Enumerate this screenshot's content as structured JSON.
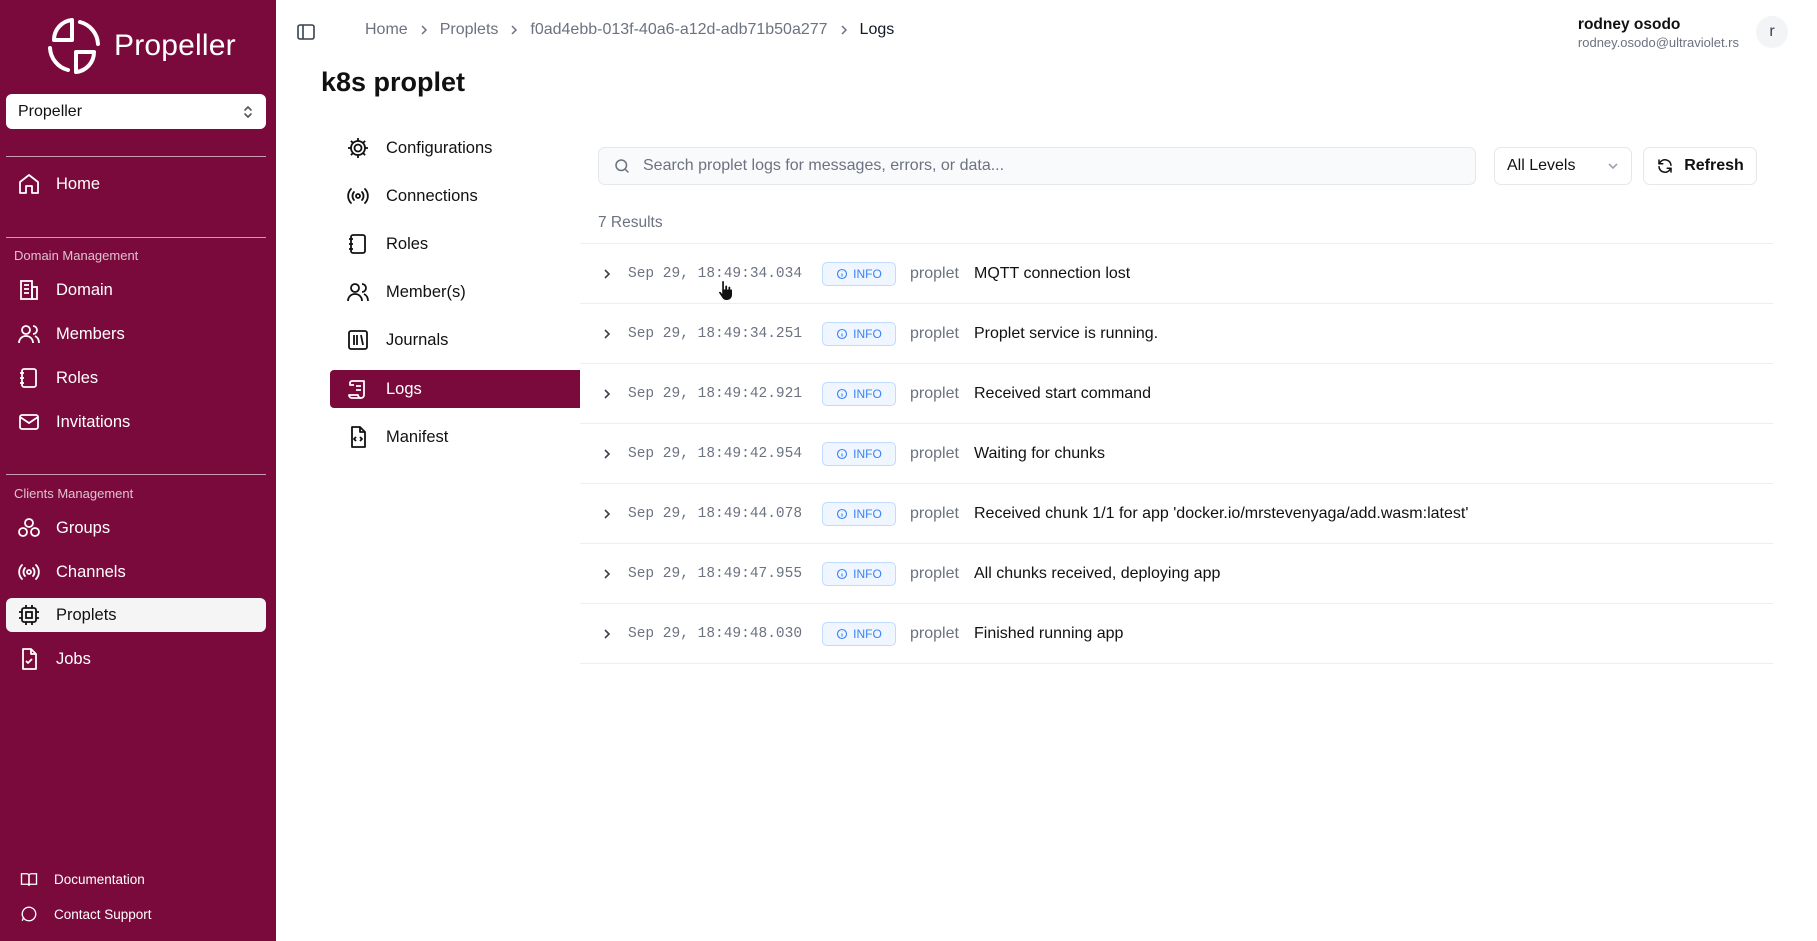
{
  "app": {
    "name": "Propeller",
    "domain_select": "Propeller"
  },
  "sidebar": {
    "home": "Home",
    "domain_management": {
      "title": "Domain Management",
      "items": [
        "Domain",
        "Members",
        "Roles",
        "Invitations"
      ]
    },
    "clients_management": {
      "title": "Clients Management",
      "items": [
        "Groups",
        "Channels",
        "Proplets",
        "Jobs"
      ]
    },
    "active_item": "Proplets",
    "footer": [
      "Documentation",
      "Contact Support"
    ]
  },
  "header": {
    "breadcrumb": [
      "Home",
      "Proplets",
      "f0ad4ebb-013f-40a6-a12d-adb71b50a277",
      "Logs"
    ],
    "user": {
      "name": "rodney osodo",
      "email": "rodney.osodo@ultraviolet.rs",
      "avatar_letter": "r"
    }
  },
  "page": {
    "title": "k8s proplet",
    "subnav": [
      "Configurations",
      "Connections",
      "Roles",
      "Member(s)",
      "Journals",
      "Logs",
      "Manifest"
    ],
    "active_subnav": "Logs"
  },
  "logs": {
    "search_placeholder": "Search proplet logs for messages, errors, or data...",
    "search_value": "",
    "level_select": "All Levels",
    "refresh_label": "Refresh",
    "results_count": "7 Results",
    "entries": [
      {
        "timestamp": "Sep 29, 18:49:34.034",
        "level": "INFO",
        "source": "proplet",
        "message": "MQTT connection lost"
      },
      {
        "timestamp": "Sep 29, 18:49:34.251",
        "level": "INFO",
        "source": "proplet",
        "message": "Proplet service is running."
      },
      {
        "timestamp": "Sep 29, 18:49:42.921",
        "level": "INFO",
        "source": "proplet",
        "message": "Received start command"
      },
      {
        "timestamp": "Sep 29, 18:49:42.954",
        "level": "INFO",
        "source": "proplet",
        "message": "Waiting for chunks"
      },
      {
        "timestamp": "Sep 29, 18:49:44.078",
        "level": "INFO",
        "source": "proplet",
        "message": "Received chunk 1/1 for app 'docker.io/mrstevenyaga/add.wasm:latest'"
      },
      {
        "timestamp": "Sep 29, 18:49:47.955",
        "level": "INFO",
        "source": "proplet",
        "message": "All chunks received, deploying app"
      },
      {
        "timestamp": "Sep 29, 18:49:48.030",
        "level": "INFO",
        "source": "proplet",
        "message": "Finished running app"
      }
    ]
  },
  "colors": {
    "brand": "#7b0a3c",
    "info_badge": "#3b82f6",
    "info_badge_bg": "#eff6ff"
  }
}
